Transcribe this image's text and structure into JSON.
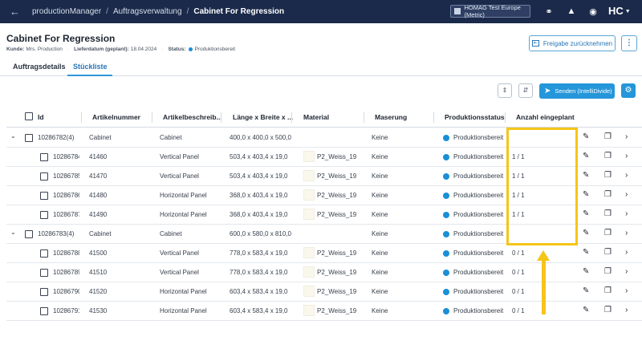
{
  "header": {
    "back_icon": "arrow-left-icon",
    "breadcrumb": [
      "productionManager",
      "Auftragsverwaltung",
      "Cabinet For Regression"
    ],
    "tenant": "HOMAG Test Europe (Metric)",
    "logo": "HC"
  },
  "order": {
    "title": "Cabinet For Regression",
    "customer_label": "Kunde:",
    "customer": "Mrs. Production",
    "delivery_label": "Lieferdatum (geplant):",
    "delivery": "18.04.2024",
    "status_label": "Status:",
    "status": "Produktionsbereit",
    "release_button": "Freigabe zurücknehmen"
  },
  "tabs": [
    "Auftragsdetails",
    "Stückliste"
  ],
  "toolbar": {
    "send_button": "Senden (IntelliDivide)"
  },
  "table": {
    "columns": [
      "Id",
      "Artikelnummer",
      "Artikelbeschreib...",
      "Länge x Breite x ...",
      "Material",
      "Maserung",
      "Produktionsstatus",
      "Anzahl eingeplant"
    ],
    "rows": [
      {
        "level": 0,
        "id": "10286782(4)",
        "article": "Cabinet",
        "desc": "Cabinet",
        "dims": "400,0 x 400,0 x 500,0",
        "material": "",
        "grain": "Keine",
        "status": "Produktionsbereit",
        "planned": ""
      },
      {
        "level": 1,
        "id": "10286784",
        "article": "41460",
        "desc": "Vertical Panel",
        "dims": "503,4 x 403,4 x 19,0",
        "material": "P2_Weiss_19",
        "grain": "Keine",
        "status": "Produktionsbereit",
        "planned": "1 / 1"
      },
      {
        "level": 1,
        "id": "10286785",
        "article": "41470",
        "desc": "Vertical Panel",
        "dims": "503,4 x 403,4 x 19,0",
        "material": "P2_Weiss_19",
        "grain": "Keine",
        "status": "Produktionsbereit",
        "planned": "1 / 1"
      },
      {
        "level": 1,
        "id": "10286786",
        "article": "41480",
        "desc": "Horizontal Panel",
        "dims": "368,0 x 403,4 x 19,0",
        "material": "P2_Weiss_19",
        "grain": "Keine",
        "status": "Produktionsbereit",
        "planned": "1 / 1"
      },
      {
        "level": 1,
        "id": "10286787",
        "article": "41490",
        "desc": "Horizontal Panel",
        "dims": "368,0 x 403,4 x 19,0",
        "material": "P2_Weiss_19",
        "grain": "Keine",
        "status": "Produktionsbereit",
        "planned": "1 / 1"
      },
      {
        "level": 0,
        "id": "10286783(4)",
        "article": "Cabinet",
        "desc": "Cabinet",
        "dims": "600,0 x 580,0 x 810,0",
        "material": "",
        "grain": "Keine",
        "status": "Produktionsbereit",
        "planned": ""
      },
      {
        "level": 1,
        "id": "10286788",
        "article": "41500",
        "desc": "Vertical Panel",
        "dims": "778,0 x 583,4 x 19,0",
        "material": "P2_Weiss_19",
        "grain": "Keine",
        "status": "Produktionsbereit",
        "planned": "0 / 1"
      },
      {
        "level": 1,
        "id": "10286789",
        "article": "41510",
        "desc": "Vertical Panel",
        "dims": "778,0 x 583,4 x 19,0",
        "material": "P2_Weiss_19",
        "grain": "Keine",
        "status": "Produktionsbereit",
        "planned": "0 / 1"
      },
      {
        "level": 1,
        "id": "10286790",
        "article": "41520",
        "desc": "Horizontal Panel",
        "dims": "603,4 x 583,4 x 19,0",
        "material": "P2_Weiss_19",
        "grain": "Keine",
        "status": "Produktionsbereit",
        "planned": "0 / 1"
      },
      {
        "level": 1,
        "id": "10286791",
        "article": "41530",
        "desc": "Horizontal Panel",
        "dims": "603,4 x 583,4 x 19,0",
        "material": "P2_Weiss_19",
        "grain": "Keine",
        "status": "Produktionsbereit",
        "planned": "0 / 1"
      }
    ]
  },
  "colors": {
    "topbar": "#1b2a4a",
    "accent": "#2496d9",
    "status_ready": "#1a8fd6",
    "annotation": "#f5c518"
  }
}
